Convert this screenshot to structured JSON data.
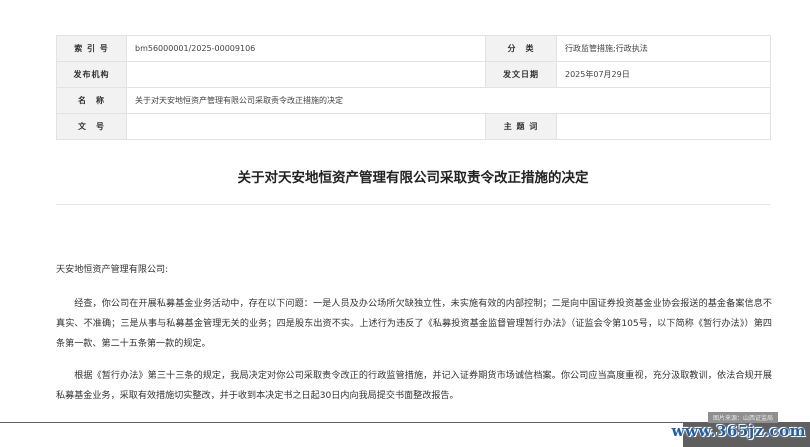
{
  "meta_table": {
    "rows": [
      {
        "k1": "索 引 号",
        "v1": "bm56000001/2025-00009106",
        "k2": "分　类",
        "v2": "行政监管措施;行政执法"
      },
      {
        "k1": "发布机构",
        "v1": "",
        "k2": "发文日期",
        "v2": "2025年07月29日"
      },
      {
        "k1": "名　称",
        "v1": "关于对天安地恒资产管理有限公司采取责令改正措施的决定"
      },
      {
        "k1": "文　号",
        "v1": "",
        "k2": "主 题 词",
        "v2": ""
      }
    ]
  },
  "document": {
    "title": "关于对天安地恒资产管理有限公司采取责令改正措施的决定",
    "addressee": "天安地恒资产管理有限公司:",
    "paragraphs": [
      "经查，你公司在开展私募基金业务活动中，存在以下问题：一是人员及办公场所欠缺独立性，未实施有效的内部控制；二是向中国证券投资基金业协会报送的基金备案信息不真实、不准确；三是从事与私募基金管理无关的业务；四是股东出资不实。上述行为违反了《私募投资基金监督管理暂行办法》（证监会令第105号，以下简称《暂行办法》）第四条第一款、第二十五条第一款的规定。",
      "根据《暂行办法》第三十三条的规定，我局决定对你公司采取责令改正的行政监管措施，并记入证券期货市场诚信档案。你公司应当高度重视，充分汲取教训，依法合规开展私募基金业务，采取有效措施切实整改，并于收到本决定书之日起30日内向我局提交书面整改报告。"
    ]
  },
  "image_caption": "图片来源：山西证监局",
  "watermark": "www.365jz.com"
}
